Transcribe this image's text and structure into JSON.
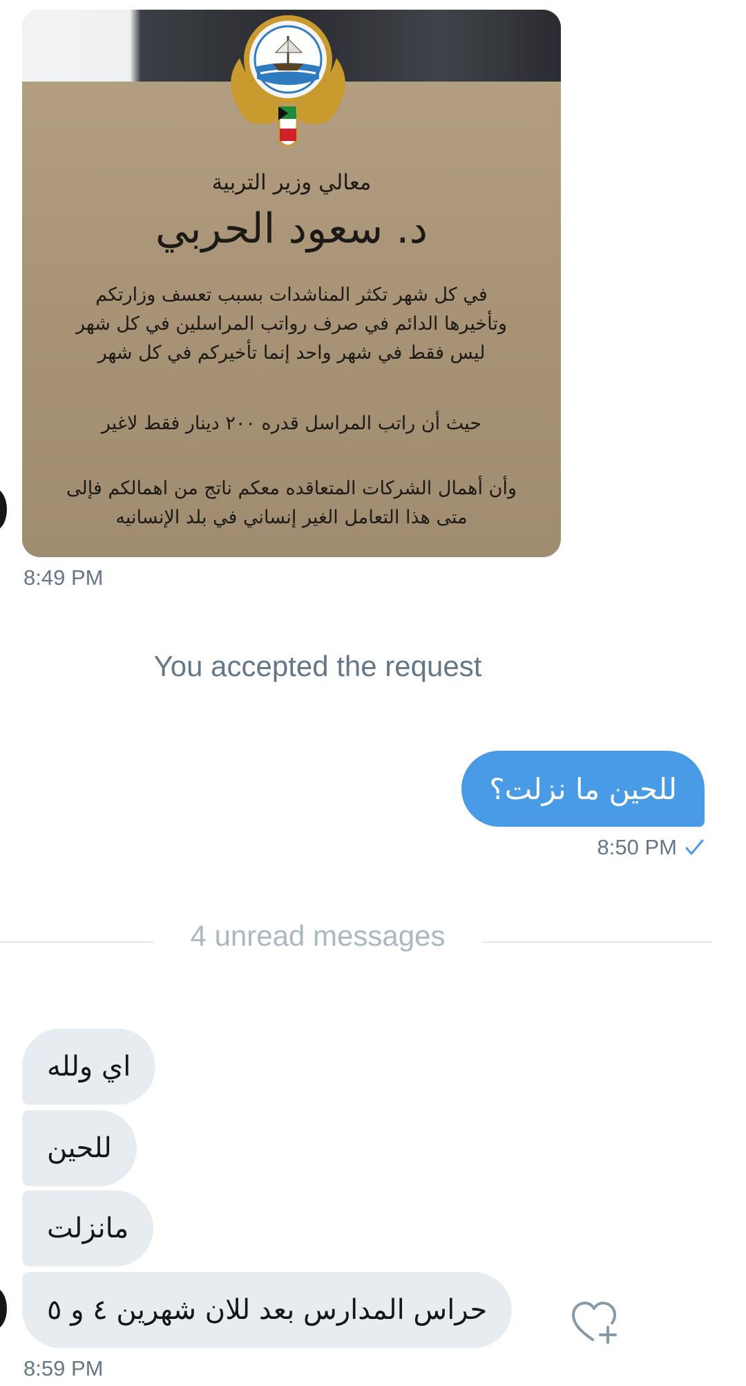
{
  "image_card": {
    "subtitle": "معالي وزير التربية",
    "title": "د. سعود الحربي",
    "paragraph_1": "في كل شهر تكثر المناشدات بسبب تعسف وزارتكم وتأخيرها الدائم في صرف رواتب المراسلين في كل شهر ليس فقط في شهر واحد إنما تأخيركم في كل شهر",
    "paragraph_2": "حيث أن راتب المراسل قدره ٢٠٠ دينار فقط لاغير",
    "paragraph_3": "وأن أهمال الشركات المتعاقده معكم ناتج من اهمالكم فإلى متى هذا التعامل الغير إنساني في بلد الإنسانيه",
    "emblem_icon": "kuwait-state-emblem",
    "background_color": "#a99478"
  },
  "image_timestamp": "8:49 PM",
  "system_note": "You accepted the request",
  "outgoing": {
    "text": "للحين ما نزلت؟",
    "timestamp": "8:50 PM",
    "status_icon": "check-icon",
    "bubble_color": "#4a9be6"
  },
  "unread_divider": "4 unread messages",
  "incoming": [
    {
      "text": "اي ولله"
    },
    {
      "text": "للحين"
    },
    {
      "text": "مانزلت"
    },
    {
      "text": "حراس المدارس بعد للان شهرين ٤ و ٥"
    }
  ],
  "incoming_bubble_color": "#e6ecf0",
  "like_icon": "heart-plus-icon",
  "last_timestamp": "8:59 PM"
}
